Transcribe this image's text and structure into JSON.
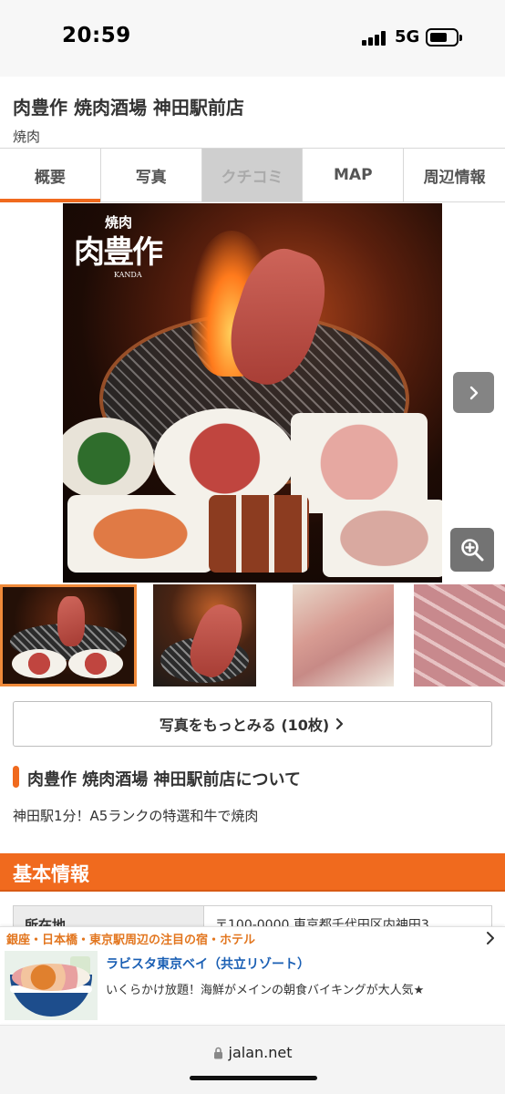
{
  "status_bar": {
    "time": "20:59",
    "network": "5G",
    "icons": [
      "signal-icon",
      "battery-icon"
    ]
  },
  "shop": {
    "name": "肉豊作 焼肉酒場 神田駅前店",
    "genre": "焼肉"
  },
  "tabs": [
    {
      "label": "概要",
      "active": true,
      "disabled": false
    },
    {
      "label": "写真",
      "active": false,
      "disabled": false
    },
    {
      "label": "クチコミ",
      "active": false,
      "disabled": true
    },
    {
      "label": "MAP",
      "active": false,
      "disabled": false
    },
    {
      "label": "周辺情報",
      "active": false,
      "disabled": false
    }
  ],
  "gallery": {
    "logo_top": "焼肉",
    "logo_main": "肉豊作",
    "logo_sub": "KANDA",
    "next_icon": "chevron-right-icon",
    "zoom_icon": "zoom-in-icon",
    "selected_thumb": 1,
    "more_label": "写真をもっとみる (10枚)"
  },
  "about": {
    "title": "肉豊作 焼肉酒場 神田駅前店について",
    "text": "神田駅1分！A5ランクの特選和牛で焼肉"
  },
  "basic_info": {
    "title": "基本情報",
    "rows": [
      {
        "key": "所在地",
        "value": "〒100-0000 東京都千代田区内神田3"
      }
    ]
  },
  "ad": {
    "header": "銀座・日本橋・東京駅周辺の注目の宿・ホテル",
    "title": "ラビスタ東京ベイ（共立リゾート）",
    "description": "いくらかけ放題！海鮮がメインの朝食バイキングが大人気★"
  },
  "browser": {
    "url": "jalan.net"
  },
  "colors": {
    "accent": "#f06a1e",
    "link": "#1a5fb4",
    "ad_header": "#e2761f"
  }
}
